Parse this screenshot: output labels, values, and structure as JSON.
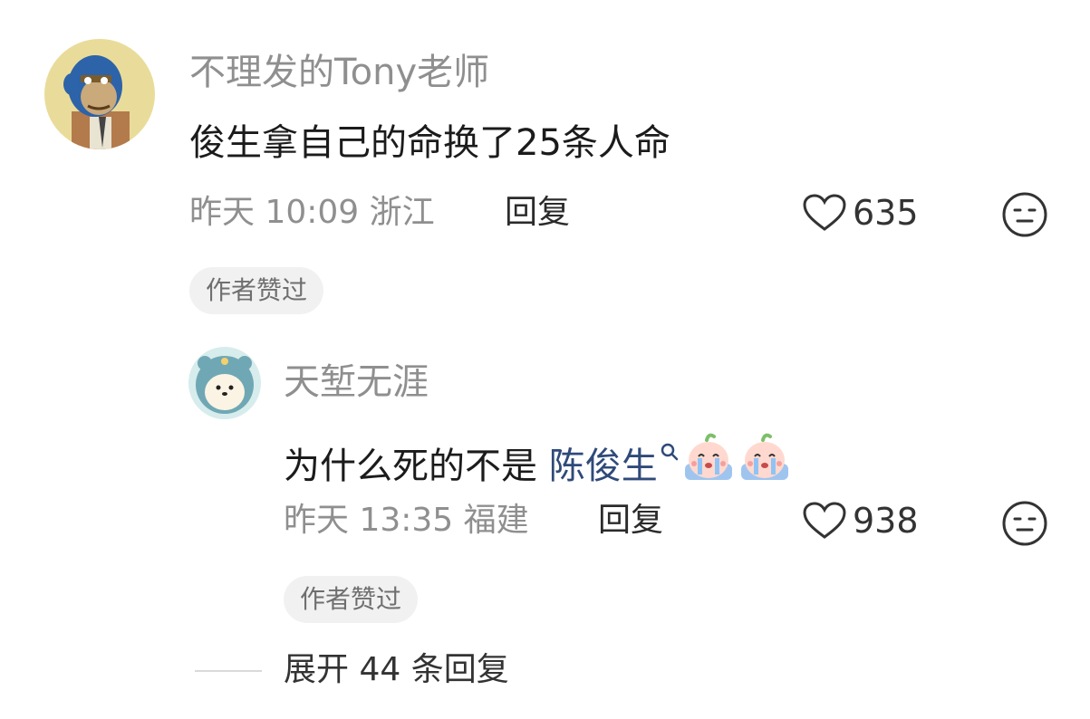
{
  "comments": [
    {
      "username": "不理发的Tony老师",
      "avatar": "bored-ape-avatar",
      "content": "俊生拿自己的命换了25条人命",
      "date": "昨天",
      "time": "10:09",
      "location": "浙江",
      "reply_label": "回复",
      "likes": "635",
      "badge": "作者赞过"
    },
    {
      "username": "天堑无涯",
      "avatar": "teddy-bear-avatar",
      "content_prefix": "为什么死的不是 ",
      "content_link": "陈俊生",
      "emojis": [
        "crying-emoji",
        "crying-emoji"
      ],
      "date": "昨天",
      "time": "13:35",
      "location": "福建",
      "reply_label": "回复",
      "likes": "938",
      "badge": "作者赞过"
    }
  ],
  "expand_replies": "展开 44 条回复",
  "colors": {
    "username": "#8f8f8f",
    "text": "#1b1b1b",
    "link": "#2f4a7a",
    "badge_bg": "#f1f1f1"
  },
  "icons": {
    "like": "heart-outline-icon",
    "dislike": "neutral-face-icon",
    "search": "search-icon"
  }
}
